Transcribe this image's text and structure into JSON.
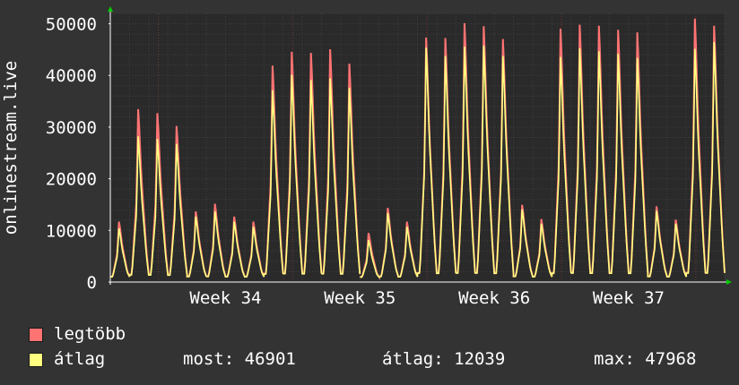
{
  "chart_data": {
    "type": "area",
    "ylabel": "onlinestream.live",
    "ylim": [
      0,
      52000
    ],
    "y_ticks": [
      "0",
      "10000",
      "20000",
      "30000",
      "40000",
      "50000"
    ],
    "x_tick_labels": [
      "Week 34",
      "Week 35",
      "Week 36",
      "Week 37"
    ],
    "grid": true,
    "legend_placement": "bottom-left",
    "series": [
      {
        "name": "legtöbb",
        "color": "#ff7373",
        "daily_peaks": [
          11800,
          33800,
          33000,
          30500,
          13800,
          15300,
          12800,
          11800,
          42300,
          45000,
          44800,
          45500,
          42700,
          9600,
          14500,
          11800,
          47800,
          47700,
          50600,
          50000,
          47500,
          15100,
          12300,
          49500,
          50300,
          50100,
          49300,
          48800,
          14800,
          12200,
          51500,
          50100
        ]
      },
      {
        "name": "átlag",
        "color": "#ffff80",
        "daily_peaks": [
          10500,
          28500,
          28000,
          27000,
          12800,
          13800,
          11800,
          10800,
          37500,
          40500,
          39500,
          39800,
          38000,
          8200,
          13500,
          10800,
          45800,
          44200,
          46000,
          46200,
          44200,
          14200,
          11400,
          44000,
          45700,
          45100,
          44600,
          43800,
          13900,
          11400,
          45600,
          46900
        ]
      }
    ],
    "gap_after_day": 12
  },
  "colors": {
    "background": "#333333",
    "plot_background": "#2a2a2a",
    "grid_minor": "#3f3f3f",
    "grid_major": "#7a3535",
    "axis": "#ffffff",
    "arrow": "#00cc00"
  },
  "legend": {
    "max_label": "legtöbb",
    "avg_label": "átlag"
  },
  "stats": {
    "now": "most: 46901",
    "avg": "átlag: 12039",
    "max": "max: 47968"
  }
}
